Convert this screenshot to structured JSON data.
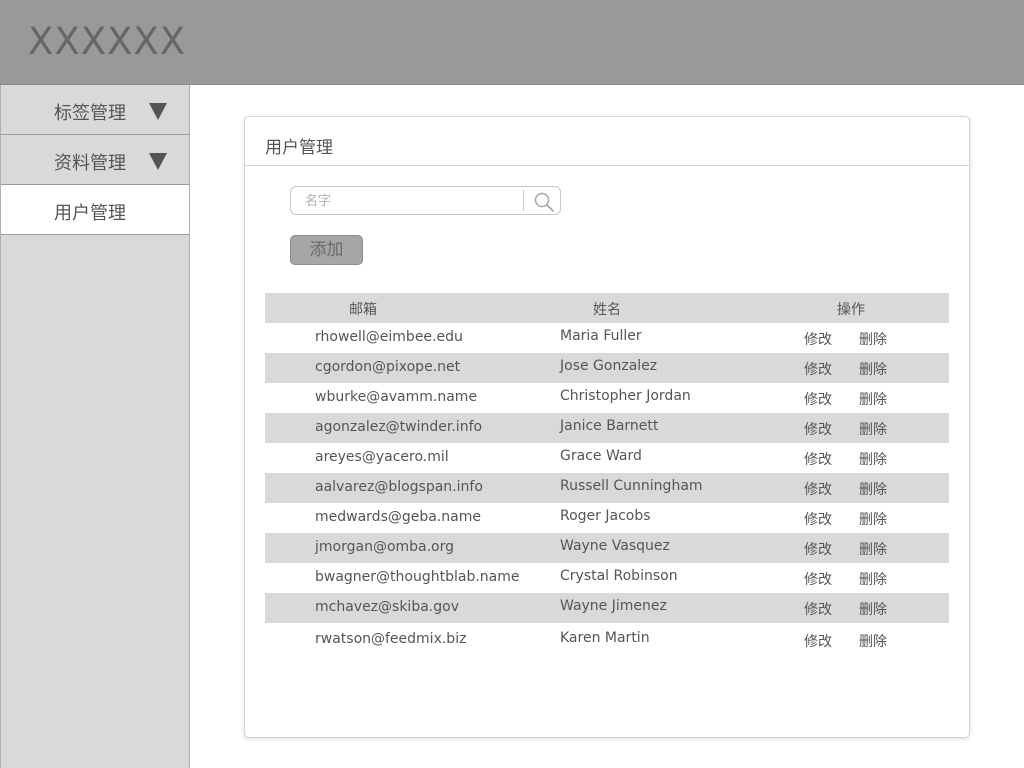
{
  "header": {
    "logo": "XXXXXX"
  },
  "sidebar": {
    "items": [
      {
        "label": "标签管理",
        "has_arrow": true,
        "active": false
      },
      {
        "label": "资料管理",
        "has_arrow": true,
        "active": false
      },
      {
        "label": "用户管理",
        "has_arrow": false,
        "active": true
      }
    ]
  },
  "panel": {
    "title": "用户管理",
    "search": {
      "placeholder": "名字",
      "value": "",
      "icon": "search-icon"
    },
    "add_label": "添加"
  },
  "table": {
    "columns": [
      "邮箱",
      "姓名",
      "操作"
    ],
    "edit_label": "修改",
    "delete_label": "删除",
    "rows": [
      {
        "email": "rhowell@eimbee.edu",
        "name": "Maria Fuller"
      },
      {
        "email": "cgordon@pixope.net",
        "name": "Jose Gonzalez"
      },
      {
        "email": "wburke@avamm.name",
        "name": "Christopher Jordan"
      },
      {
        "email": "agonzalez@twinder.info",
        "name": "Janice Barnett"
      },
      {
        "email": "areyes@yacero.mil",
        "name": "Grace Ward"
      },
      {
        "email": "aalvarez@blogspan.info",
        "name": "Russell Cunningham"
      },
      {
        "email": "medwards@geba.name",
        "name": "Roger Jacobs"
      },
      {
        "email": "jmorgan@omba.org",
        "name": "Wayne Vasquez"
      },
      {
        "email": "bwagner@thoughtblab.name",
        "name": "Crystal Robinson"
      },
      {
        "email": "mchavez@skiba.gov",
        "name": "Wayne Jimenez"
      },
      {
        "email": "rwatson@feedmix.biz",
        "name": "Karen Martin"
      }
    ]
  },
  "colors": {
    "header_bg": "#999999",
    "sidebar_bg": "#d9d9d9",
    "row_alt_bg": "#d9d9d9",
    "button_bg": "#a6a6a6",
    "text": "#555555"
  }
}
